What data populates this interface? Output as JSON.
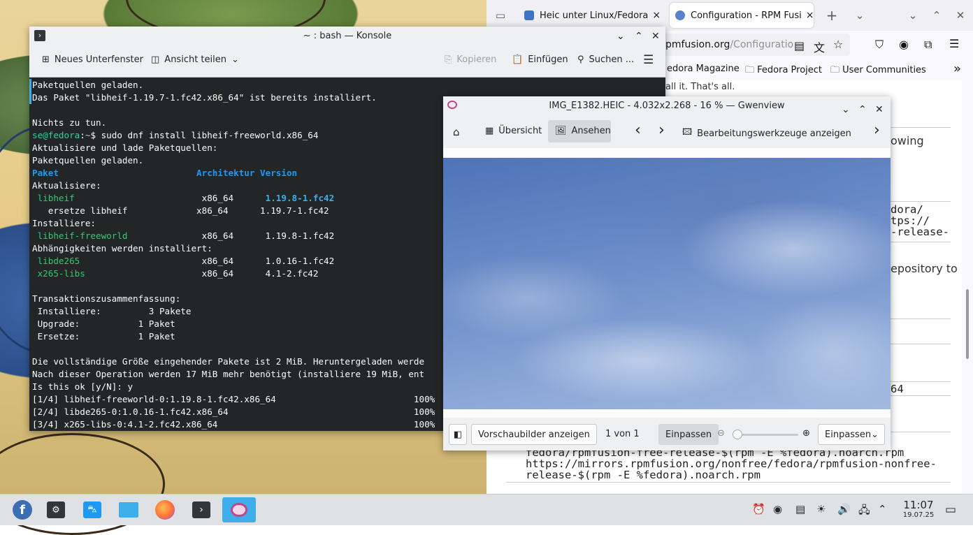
{
  "firefox": {
    "tabs": [
      {
        "label": "Heic unter Linux/Fedora",
        "close": "×"
      },
      {
        "label": "Configuration - RPM Fusi",
        "close": "×"
      }
    ],
    "new_tab": "+",
    "tab_list": "⌄",
    "window_controls": {
      "minimize": "⌄",
      "maximize": "⌃",
      "close": "✕"
    },
    "url": {
      "host": "pmfusion.org",
      "path": "/Configuratio"
    },
    "bookmarks": [
      "edora Magazine",
      "Fedora Project",
      "User Communities"
    ],
    "bookmarks_more": "»",
    "page": {
      "line1": "all it. That's all.",
      "line2": "owing",
      "code1": "dora/\ntps://\n-release-",
      "line3": "epository to",
      "code2": "64",
      "code3": "free/\nfedora/rpmfusion-free-release-$(rpm -E %fedora).noarch.rpm\nhttps://mirrors.rpmfusion.org/nonfree/fedora/rpmfusion-nonfree-\nrelease-$(rpm -E %fedora).noarch.rpm"
    }
  },
  "konsole": {
    "title": "~ : bash — Konsole",
    "window_controls": {
      "minimize": "⌄",
      "maximize": "⌃",
      "close": "✕"
    },
    "toolbar": {
      "new_tab": "Neues Unterfenster",
      "split_view": "Ansicht teilen",
      "copy": "Kopieren",
      "paste": "Einfügen",
      "search": "Suchen ...",
      "menu": "☰"
    },
    "lines": [
      {
        "segs": [
          {
            "t": "Paketquellen geladen."
          }
        ]
      },
      {
        "segs": [
          {
            "t": "Das Paket \"libheif-1.19.7-1.fc42.x86_64\" ist bereits installiert."
          }
        ]
      },
      {
        "segs": [
          {
            "t": ""
          }
        ]
      },
      {
        "segs": [
          {
            "t": "Nichts zu tun."
          }
        ]
      },
      {
        "segs": [
          {
            "t": "se@fedora",
            "c": "c-green"
          },
          {
            "t": ":",
            "c": ""
          },
          {
            "t": "~",
            "c": "c-gray"
          },
          {
            "t": "$ sudo dnf install libheif-freeworld.x86_64"
          }
        ]
      },
      {
        "segs": [
          {
            "t": "Aktualisiere und lade Paketquellen:"
          }
        ]
      },
      {
        "segs": [
          {
            "t": "Paketquellen geladen."
          }
        ]
      },
      {
        "segs": [
          {
            "t": "Paket                          ",
            "c": "c-blue"
          },
          {
            "t": "Architektur Version",
            "c": "c-blue"
          }
        ]
      },
      {
        "segs": [
          {
            "t": "Aktualisiere:"
          }
        ]
      },
      {
        "segs": [
          {
            "t": " libheif",
            "c": "c-greenb"
          },
          {
            "t": "                        x86_64      "
          },
          {
            "t": "1.19.8-1.fc42",
            "c": "c-lblue"
          }
        ]
      },
      {
        "segs": [
          {
            "t": "   ersetze libheif             x86_64      1.19.7-1.fc42"
          }
        ]
      },
      {
        "segs": [
          {
            "t": "Installiere:"
          }
        ]
      },
      {
        "segs": [
          {
            "t": " libheif-freeworld",
            "c": "c-greenb"
          },
          {
            "t": "              x86_64      1.19.8-1.fc42"
          }
        ]
      },
      {
        "segs": [
          {
            "t": "Abhängigkeiten werden installiert:"
          }
        ]
      },
      {
        "segs": [
          {
            "t": " libde265",
            "c": "c-greenb"
          },
          {
            "t": "                       x86_64      1.0.16-1.fc42"
          }
        ]
      },
      {
        "segs": [
          {
            "t": " x265-libs",
            "c": "c-greenb"
          },
          {
            "t": "                      x86_64      4.1-2.fc42"
          }
        ]
      },
      {
        "segs": [
          {
            "t": ""
          }
        ]
      },
      {
        "segs": [
          {
            "t": "Transaktionszusammenfassung:"
          }
        ]
      },
      {
        "segs": [
          {
            "t": " Installiere:         3 Pakete"
          }
        ]
      },
      {
        "segs": [
          {
            "t": " Upgrade:           1 Paket"
          }
        ]
      },
      {
        "segs": [
          {
            "t": " Ersetze:           1 Paket"
          }
        ]
      },
      {
        "segs": [
          {
            "t": ""
          }
        ]
      },
      {
        "segs": [
          {
            "t": "Die vollständige Größe eingehender Pakete ist 2 MiB. Heruntergeladen werde"
          }
        ]
      },
      {
        "segs": [
          {
            "t": "Nach dieser Operation werden 17 MiB mehr benötigt (installiere 19 MiB, ent"
          }
        ]
      },
      {
        "segs": [
          {
            "t": "Is this ok [y/N]: y"
          }
        ]
      },
      {
        "segs": [
          {
            "t": "[1/4] libheif-freeworld-0:1.19.8-1.fc42.x86_64                          100%"
          }
        ]
      },
      {
        "segs": [
          {
            "t": "[2/4] libde265-0:1.0.16-1.fc42.x86_64                                   100%"
          }
        ]
      },
      {
        "segs": [
          {
            "t": "[3/4] x265-libs-0:4.1-2.fc42.x86_64                                     100%"
          }
        ]
      }
    ]
  },
  "gwenview": {
    "title": "IMG_E1382.HEIC - 4.032x2.268 - 16 % — Gwenview",
    "window_controls": {
      "minimize": "⌄",
      "maximize": "⌃",
      "close": "✕"
    },
    "toolbar": {
      "overview": "Übersicht",
      "view": "Ansehen",
      "prev": "‹",
      "next": "›",
      "edit_tools": "Bearbeitungswerkzeuge anzeigen",
      "more": "›"
    },
    "status": {
      "thumbnails": "Vorschaubilder anzeigen",
      "counter": "1 von 1",
      "fit": "Einpassen",
      "zoom_select": "Einpassen",
      "zoom_level": 0
    }
  },
  "taskbar": {
    "clock_time": "11:07",
    "clock_date": "19.07.25",
    "apps": [
      "fedora-launcher-icon",
      "system-settings-icon",
      "discover-icon",
      "dolphin-icon",
      "firefox-icon",
      "konsole-icon",
      "gwenview-icon"
    ]
  }
}
